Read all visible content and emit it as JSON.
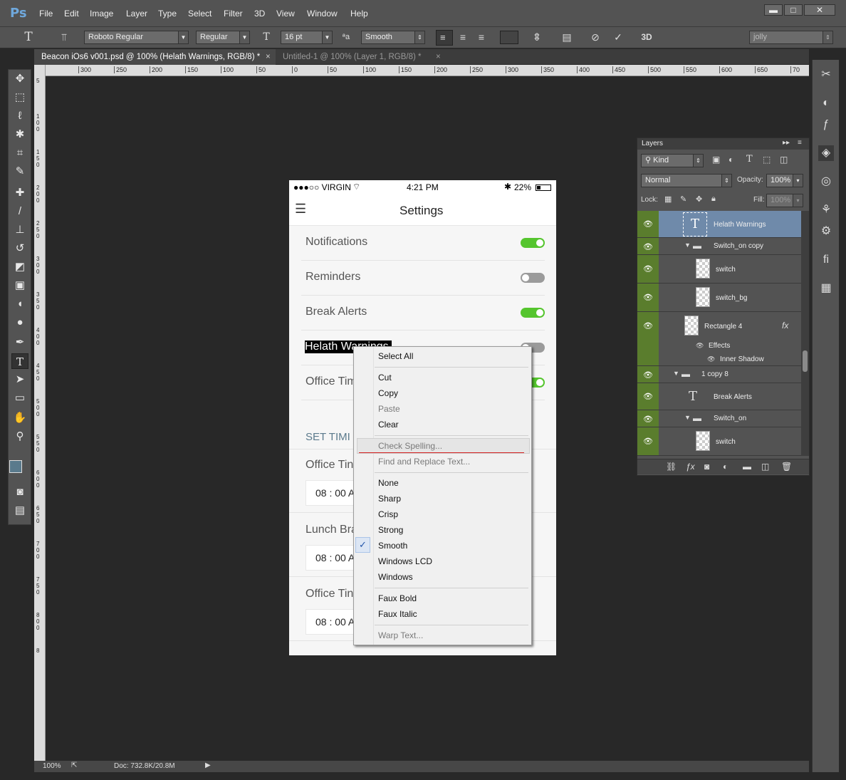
{
  "app": {
    "logo": "Ps"
  },
  "menu": [
    "File",
    "Edit",
    "Image",
    "Layer",
    "Type",
    "Select",
    "Filter",
    "3D",
    "View",
    "Window",
    "Help"
  ],
  "window_controls": {
    "minimize": "▬",
    "maximize": "□",
    "close": "✕"
  },
  "options": {
    "font_family": "Roboto Regular",
    "font_style": "Regular",
    "font_size": "16 pt",
    "aa_label": "ªa",
    "antialias": "Smooth",
    "workspace": "jolly",
    "label_3d": "3D"
  },
  "tabs": [
    {
      "title": "Beacon iOs6 v001.psd @ 100% (Helath Warnings, RGB/8) *",
      "close": "×"
    },
    {
      "title": "Untitled-1 @ 100% (Layer 1, RGB/8) *",
      "close": "×"
    }
  ],
  "ruler_h": [
    "300",
    "250",
    "200",
    "150",
    "100",
    "50",
    "0",
    "50",
    "100",
    "150",
    "200",
    "250",
    "300",
    "350",
    "400",
    "450",
    "500",
    "550",
    "600",
    "650",
    "70"
  ],
  "ruler_v": [
    "5",
    "1 0 0",
    "1 5 0",
    "2 0 0",
    "2 5 0",
    "3 0 0",
    "3 5 0",
    "4 0 0",
    "4 5 0",
    "5 0 0",
    "5 5 0",
    "6 0 0",
    "6 5 0",
    "7 0 0",
    "7 5 0",
    "8 0 0",
    "8"
  ],
  "status": {
    "zoom": "100%",
    "doc": "Doc: 732.8K/20.8M"
  },
  "phone": {
    "carrier": "●●●○○ VIRGIN",
    "time": "4:21 PM",
    "battery": "22%",
    "nav_title": "Settings",
    "rows": [
      {
        "label": "Notifications",
        "on": true
      },
      {
        "label": "Reminders",
        "on": false
      },
      {
        "label": "Break Alerts",
        "on": true
      },
      {
        "label": "Helath Warnings",
        "on": false
      },
      {
        "label": "Office Tim",
        "on": true
      }
    ],
    "section_header": "SET TIMI",
    "time_rows": [
      {
        "label": "Office Tin",
        "value": "08 : 00 A"
      },
      {
        "label": "Lunch Bra",
        "value": "08 : 00 A"
      },
      {
        "label": "Office Tin",
        "value": "08 : 00 A"
      }
    ]
  },
  "context_menu": {
    "select_all": "Select All",
    "cut": "Cut",
    "copy": "Copy",
    "paste": "Paste",
    "clear": "Clear",
    "check_spelling": "Check Spelling...",
    "find_replace": "Find and Replace Text...",
    "aa_options": [
      "None",
      "Sharp",
      "Crisp",
      "Strong",
      "Smooth",
      "Windows LCD",
      "Windows"
    ],
    "checked": "✓",
    "faux_bold": "Faux Bold",
    "faux_italic": "Faux Italic",
    "warp_text": "Warp Text..."
  },
  "layers_panel": {
    "title": "Layers",
    "kind": "Kind",
    "blend": "Normal",
    "opacity_label": "Opacity:",
    "opacity": "100%",
    "lock_label": "Lock:",
    "fill_label": "Fill:",
    "fill": "100%",
    "items": [
      {
        "name": "Helath Warnings",
        "type": "text"
      },
      {
        "name": "Switch_on copy",
        "type": "group"
      },
      {
        "name": "switch",
        "type": "pixel"
      },
      {
        "name": "switch_bg",
        "type": "pixel"
      },
      {
        "name": "Rectangle 4",
        "type": "shape"
      },
      {
        "name": "Effects",
        "type": "effect"
      },
      {
        "name": "Inner Shadow",
        "type": "effect"
      },
      {
        "name": "1 copy 8",
        "type": "group"
      },
      {
        "name": "Break Alerts",
        "type": "text"
      },
      {
        "name": "Switch_on",
        "type": "group"
      },
      {
        "name": "switch",
        "type": "pixel"
      }
    ],
    "fx": "fx"
  }
}
